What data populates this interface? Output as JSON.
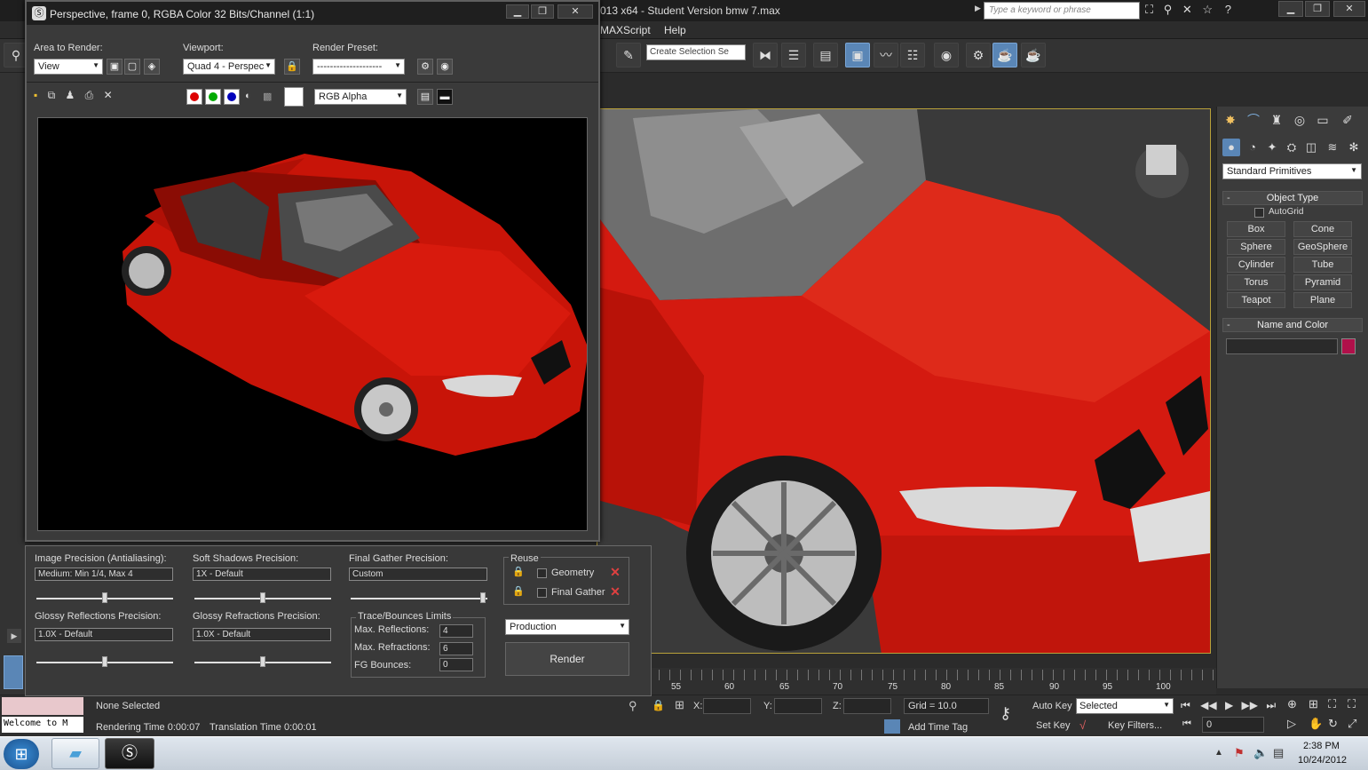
{
  "app": {
    "title": "013 x64  -  Student Version     bmw 7.max",
    "search_placeholder": "Type a keyword or phrase"
  },
  "menubar": {
    "items": [
      "MAXScript",
      "Help"
    ]
  },
  "toolbar": {
    "selection_set": "Create Selection Se"
  },
  "render_window": {
    "title": "Perspective, frame 0, RGBA Color 32 Bits/Channel (1:1)",
    "area_label": "Area to Render:",
    "area_value": "View",
    "viewport_label": "Viewport:",
    "viewport_value": "Quad 4 - Perspec",
    "preset_label": "Render Preset:",
    "preset_value": "--------------------",
    "channel_value": "RGB Alpha"
  },
  "render_setup": {
    "image_precision_label": "Image Precision (Antialiasing):",
    "image_precision_value": "Medium: Min 1/4, Max 4",
    "soft_shadows_label": "Soft Shadows Precision:",
    "soft_shadows_value": "1X - Default",
    "final_gather_label": "Final Gather Precision:",
    "final_gather_value": "Custom",
    "reuse_label": "Reuse",
    "geometry_label": "Geometry",
    "final_gather_check_label": "Final Gather",
    "glossy_reflections_label": "Glossy Reflections Precision:",
    "glossy_reflections_value": "1.0X - Default",
    "glossy_refractions_label": "Glossy Refractions Precision:",
    "glossy_refractions_value": "1.0X - Default",
    "trace_label": "Trace/Bounces Limits",
    "max_reflections_label": "Max. Reflections:",
    "max_reflections_value": "4",
    "max_refractions_label": "Max. Refractions:",
    "max_refractions_value": "6",
    "fg_bounces_label": "FG Bounces:",
    "fg_bounces_value": "0",
    "mode_value": "Production",
    "render_button": "Render"
  },
  "command_panel": {
    "dropdown": "Standard Primitives",
    "object_type_title": "Object Type",
    "autogrid_label": "AutoGrid",
    "primitives": [
      "Box",
      "Cone",
      "Sphere",
      "GeoSphere",
      "Cylinder",
      "Tube",
      "Torus",
      "Pyramid",
      "Teapot",
      "Plane"
    ],
    "name_color_title": "Name and Color",
    "object_color": "#b0104a"
  },
  "timeline": {
    "ticks": [
      "55",
      "60",
      "65",
      "70",
      "75",
      "80",
      "85",
      "90",
      "95",
      "100"
    ]
  },
  "status": {
    "selection": "None Selected",
    "rendering_time": "Rendering Time  0:00:07",
    "translation_time": "Translation Time  0:00:01",
    "listener": "Welcome to M",
    "x_label": "X:",
    "y_label": "Y:",
    "z_label": "Z:",
    "grid": "Grid = 10.0",
    "add_time_tag": "Add Time Tag",
    "auto_key": "Auto Key",
    "set_key": "Set Key",
    "selected_value": "Selected",
    "key_filters": "Key Filters...",
    "frame_value": "0"
  },
  "taskbar": {
    "time": "2:38 PM",
    "date": "10/24/2012"
  },
  "colors": {
    "viewport_border": "#b9a13a",
    "car_red": "#d41a10",
    "active_tool": "#5a86b6"
  }
}
